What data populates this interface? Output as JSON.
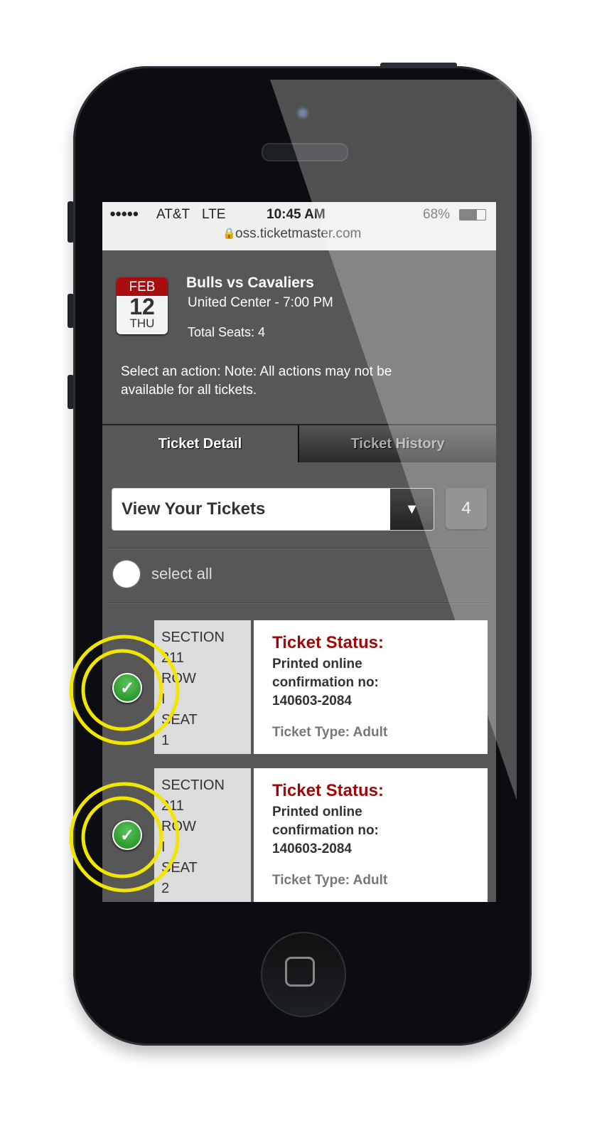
{
  "status_bar": {
    "signal": "●●●●●",
    "carrier": "AT&T",
    "network": "LTE",
    "time": "10:45 AM",
    "battery": "68%",
    "battery_level": 0.68
  },
  "address_bar": {
    "url": "oss.ticketmaster.com",
    "lock_icon": "lock-icon"
  },
  "event": {
    "month": "FEB",
    "day": "12",
    "weekday": "THU",
    "title": "Bulls vs Cavaliers",
    "venue_time": "United Center - 7:00 PM",
    "total_seats": "Total Seats: 4"
  },
  "note": "Select an action: Note: All actions may not be available for all tickets.",
  "tabs": [
    {
      "label": "Ticket Detail",
      "active": true
    },
    {
      "label": "Ticket History",
      "active": false
    }
  ],
  "action_select": {
    "value": "View Your Tickets",
    "arrow": "▼"
  },
  "ticket_count": "4",
  "select_all": "select all",
  "tickets": [
    {
      "section_label": "SECTION",
      "section": "211",
      "row_label": "ROW",
      "row": "I",
      "seat_label": "SEAT",
      "seat": "1",
      "status_title": "Ticket Status:",
      "status_line1": "Printed online",
      "status_line2": "confirmation no:",
      "confirmation": "140603-2084",
      "type": "Ticket Type: Adult",
      "selected": true
    },
    {
      "section_label": "SECTION",
      "section": "211",
      "row_label": "ROW",
      "row": "I",
      "seat_label": "SEAT",
      "seat": "2",
      "status_title": "Ticket Status:",
      "status_line1": "Printed online",
      "status_line2": "confirmation no:",
      "confirmation": "140603-2084",
      "type": "Ticket Type: Adult",
      "selected": true
    }
  ],
  "colors": {
    "accent_red": "#9e0a0a",
    "calendar_red": "#a80c0c",
    "highlight_yellow": "#f2e600",
    "check_green": "#2a9a2a"
  }
}
